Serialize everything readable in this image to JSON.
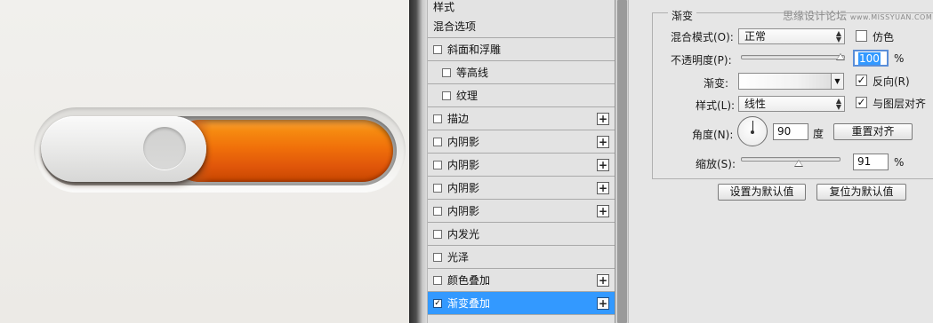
{
  "layer_styles_list": {
    "header": "样式",
    "items": [
      {
        "label": "混合选项",
        "checkbox": false,
        "has_checkbox": false,
        "indent": false,
        "plus": false,
        "selected": false
      },
      {
        "label": "斜面和浮雕",
        "checkbox": false,
        "has_checkbox": true,
        "indent": false,
        "plus": false,
        "selected": false
      },
      {
        "label": "等高线",
        "checkbox": false,
        "has_checkbox": true,
        "indent": true,
        "plus": false,
        "selected": false
      },
      {
        "label": "纹理",
        "checkbox": false,
        "has_checkbox": true,
        "indent": true,
        "plus": false,
        "selected": false
      },
      {
        "label": "描边",
        "checkbox": false,
        "has_checkbox": true,
        "indent": false,
        "plus": true,
        "selected": false
      },
      {
        "label": "内阴影",
        "checkbox": false,
        "has_checkbox": true,
        "indent": false,
        "plus": true,
        "selected": false
      },
      {
        "label": "内阴影",
        "checkbox": false,
        "has_checkbox": true,
        "indent": false,
        "plus": true,
        "selected": false
      },
      {
        "label": "内阴影",
        "checkbox": false,
        "has_checkbox": true,
        "indent": false,
        "plus": true,
        "selected": false
      },
      {
        "label": "内阴影",
        "checkbox": false,
        "has_checkbox": true,
        "indent": false,
        "plus": true,
        "selected": false
      },
      {
        "label": "内发光",
        "checkbox": false,
        "has_checkbox": true,
        "indent": false,
        "plus": false,
        "selected": false
      },
      {
        "label": "光泽",
        "checkbox": false,
        "has_checkbox": true,
        "indent": false,
        "plus": false,
        "selected": false
      },
      {
        "label": "颜色叠加",
        "checkbox": false,
        "has_checkbox": true,
        "indent": false,
        "plus": true,
        "selected": false
      },
      {
        "label": "渐变叠加",
        "checkbox": true,
        "has_checkbox": true,
        "indent": false,
        "plus": true,
        "selected": true
      }
    ],
    "check_mark": "✓",
    "plus_mark": "+"
  },
  "gradient_panel": {
    "group_title": "渐变",
    "watermark": {
      "main": "思缘设计论坛",
      "small": "www.MISSYUAN.COM"
    },
    "blend_mode": {
      "label": "混合模式(O):",
      "value": "正常"
    },
    "dither": {
      "label": "仿色",
      "checked": false
    },
    "opacity": {
      "label": "不透明度(P):",
      "value": "100",
      "unit": "%",
      "level": 100
    },
    "gradient": {
      "label": "渐变:"
    },
    "reverse": {
      "label": "反向(R)",
      "checked": true
    },
    "style": {
      "label": "样式(L):",
      "value": "线性"
    },
    "align_with_layer": {
      "label": "与图层对齐",
      "checked": true
    },
    "angle": {
      "label": "角度(N):",
      "value": "90",
      "unit": "度"
    },
    "reset_alignment": "重置对齐",
    "scale": {
      "label": "缩放(S):",
      "value": "91",
      "unit": "%",
      "level": 91
    },
    "set_default": "设置为默认值",
    "reset_default": "复位为默认值"
  },
  "colors": {
    "toggle_orange": "#f0700a",
    "selection_blue": "#3399ff",
    "panel_gray": "#e6e6e6"
  },
  "icons": {
    "dropdown": "updown-arrow-icon",
    "gradient_dropdown": "chevron-down-icon"
  }
}
